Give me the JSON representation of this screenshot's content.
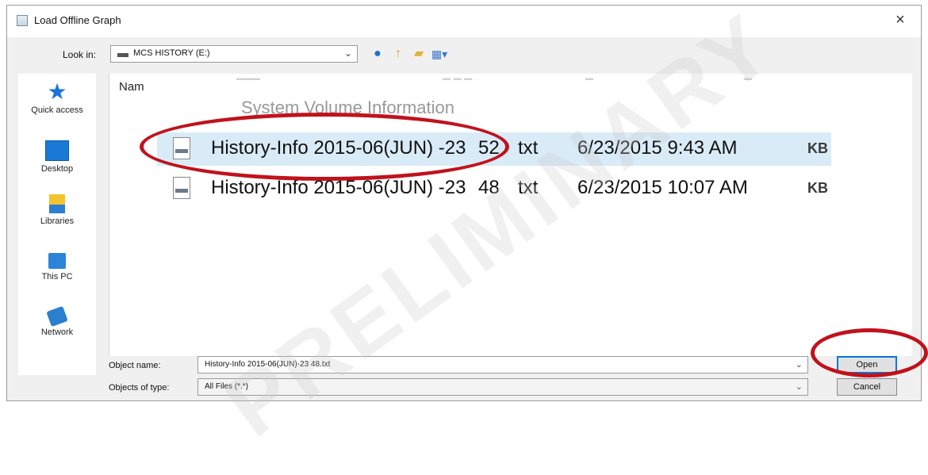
{
  "window": {
    "title": "Load Offline Graph",
    "close_glyph": "×"
  },
  "toolbar": {
    "lookin_label": "Look in:",
    "lookin_value": "MCS HISTORY (E:)",
    "icons": [
      "back-icon",
      "up-folder-icon",
      "new-folder-icon",
      "view-menu-icon"
    ]
  },
  "places": [
    {
      "label": "Quick access",
      "icon": "star-icon"
    },
    {
      "label": "Desktop",
      "icon": "desktop-icon"
    },
    {
      "label": "Libraries",
      "icon": "libraries-icon"
    },
    {
      "label": "This PC",
      "icon": "computer-icon"
    },
    {
      "label": "Network",
      "icon": "network-icon"
    }
  ],
  "filelist": {
    "column_name": "Nam",
    "folder": "System Volume Information",
    "files": [
      {
        "name": "History-Info 2015-06(JUN) -23",
        "size": "52",
        "type": "txt",
        "date": "6/23/2015 9:43 AM",
        "unit": "KB",
        "selected": true
      },
      {
        "name": "History-Info 2015-06(JUN) -23",
        "size": "48",
        "type": "txt",
        "date": "6/23/2015 10:07 AM",
        "unit": "KB",
        "selected": false
      }
    ]
  },
  "form": {
    "object_name_label": "Object name:",
    "object_name_value": "History-Info 2015-06(JUN)-23  48.txt",
    "object_type_label": "Objects of type:",
    "object_type_value": "All Files (*.*)",
    "open_label": "Open",
    "cancel_label": "Cancel"
  },
  "watermark": "PRELIMINARY",
  "annotation_color": "#c1121c"
}
